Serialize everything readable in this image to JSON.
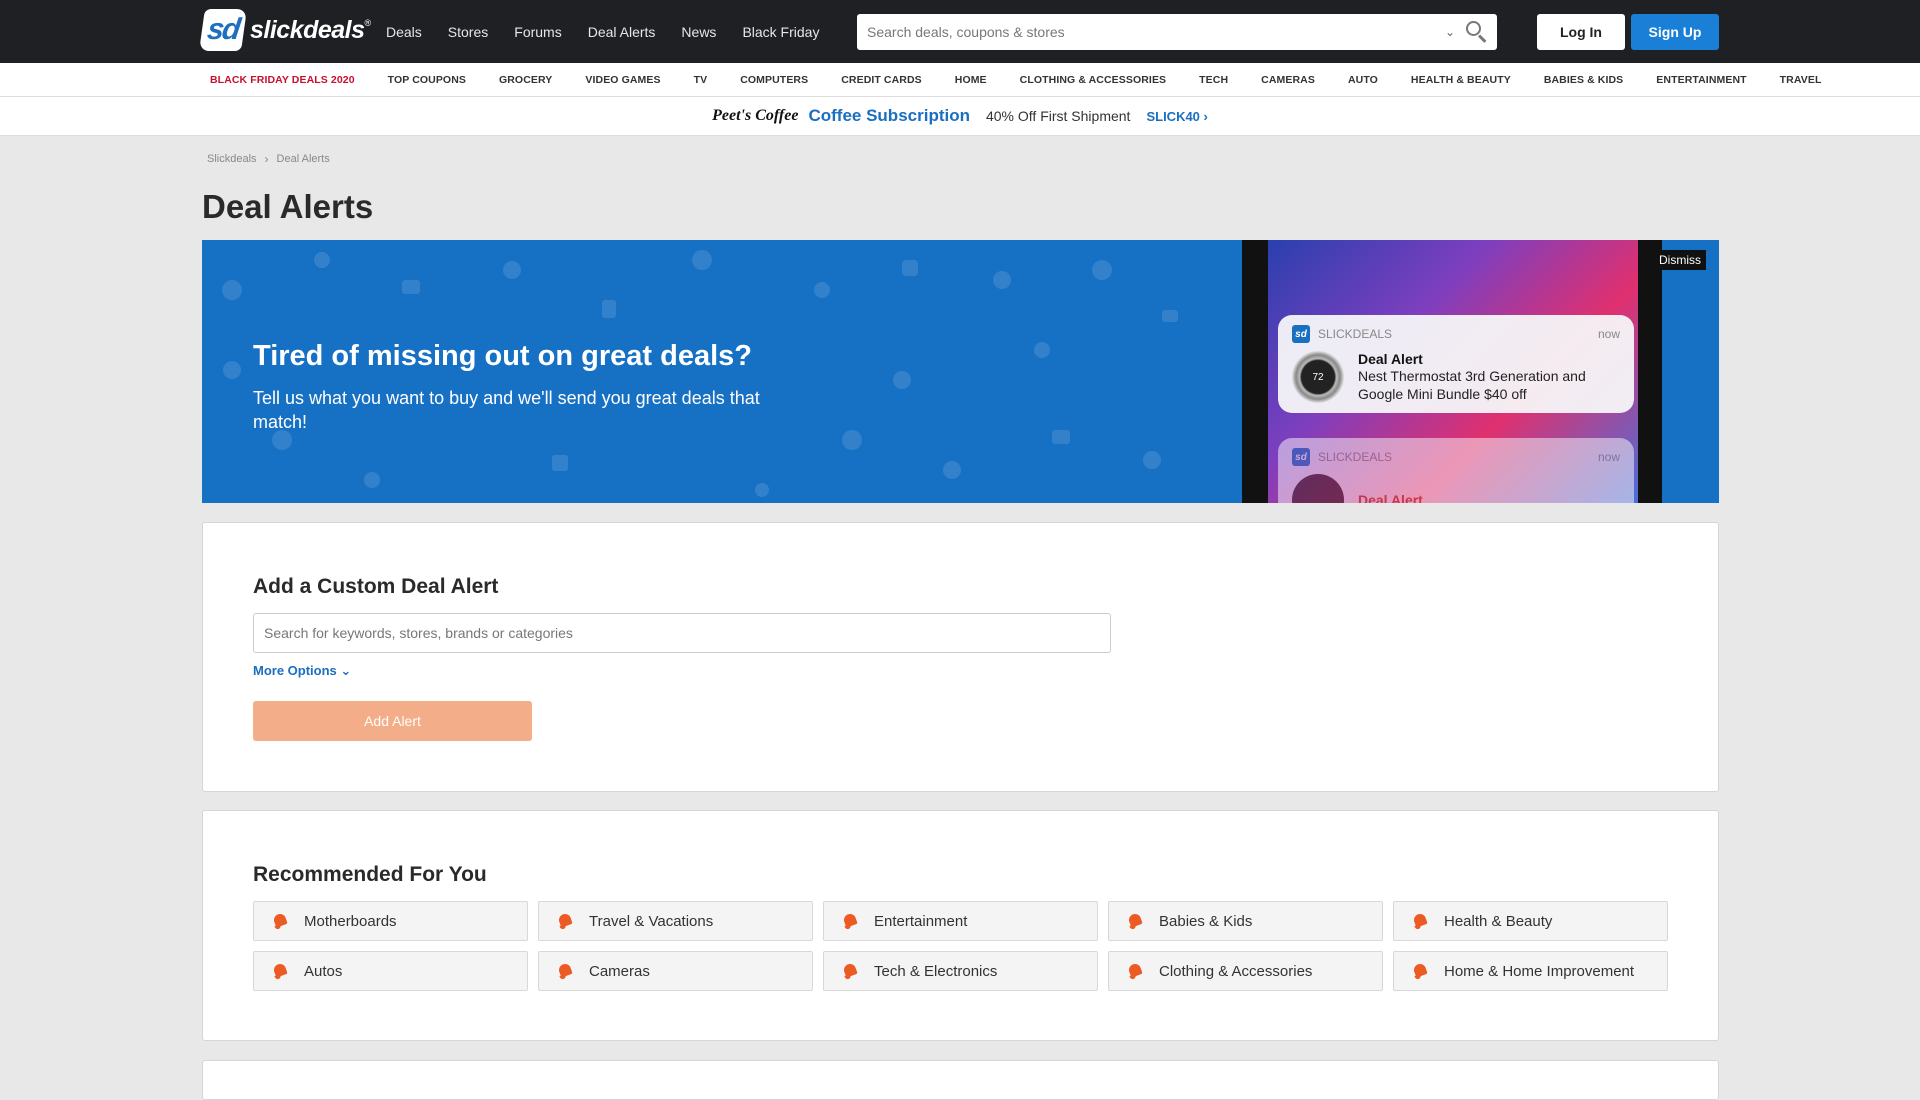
{
  "header": {
    "logo_text": "slickdeals",
    "logo_mark": "sd",
    "logo_reg": "®",
    "nav": [
      "Deals",
      "Stores",
      "Forums",
      "Deal Alerts",
      "News",
      "Black Friday"
    ],
    "search_placeholder": "Search deals, coupons & stores",
    "login_label": "Log In",
    "signup_label": "Sign Up"
  },
  "categories": [
    "BLACK FRIDAY DEALS 2020",
    "TOP COUPONS",
    "GROCERY",
    "VIDEO GAMES",
    "TV",
    "COMPUTERS",
    "CREDIT CARDS",
    "HOME",
    "CLOTHING & ACCESSORIES",
    "TECH",
    "CAMERAS",
    "AUTO",
    "HEALTH & BEAUTY",
    "BABIES & KIDS",
    "ENTERTAINMENT",
    "TRAVEL"
  ],
  "promo": {
    "brand": "Peet's Coffee",
    "title": "Coffee Subscription",
    "desc": "40% Off First Shipment",
    "code": "SLICK40"
  },
  "breadcrumb": [
    "Slickdeals",
    "Deal Alerts"
  ],
  "page_title": "Deal Alerts",
  "banner": {
    "headline": "Tired of missing out on great deals?",
    "sub": "Tell us what you want to buy and we'll send you great deals that match!",
    "dismiss_label": "Dismiss",
    "notifications": [
      {
        "app": "SLICKDEALS",
        "time": "now",
        "title": "Deal Alert",
        "text": "Nest Thermostat 3rd Generation and Google Mini Bundle $40 off",
        "thumb_text": "72"
      },
      {
        "app": "SLICKDEALS",
        "time": "now",
        "title": "Deal Alert",
        "text": ""
      }
    ]
  },
  "custom_alert": {
    "title": "Add a Custom Deal Alert",
    "placeholder": "Search for keywords, stores, brands or categories",
    "more_options": "More Options",
    "add_label": "Add Alert"
  },
  "recommended": {
    "title": "Recommended For You",
    "items": [
      "Motherboards",
      "Travel & Vacations",
      "Entertainment",
      "Babies & Kids",
      "Health & Beauty",
      "Autos",
      "Cameras",
      "Tech & Electronics",
      "Clothing & Accessories",
      "Home & Home Improvement"
    ]
  },
  "colors": {
    "header_bg": "#1f2024",
    "accent_blue": "#1a7fd6",
    "banner_blue": "#1670c4",
    "hot_red": "#c8102e",
    "bell_orange": "#ec5b24",
    "add_button": "#f3ad88"
  }
}
